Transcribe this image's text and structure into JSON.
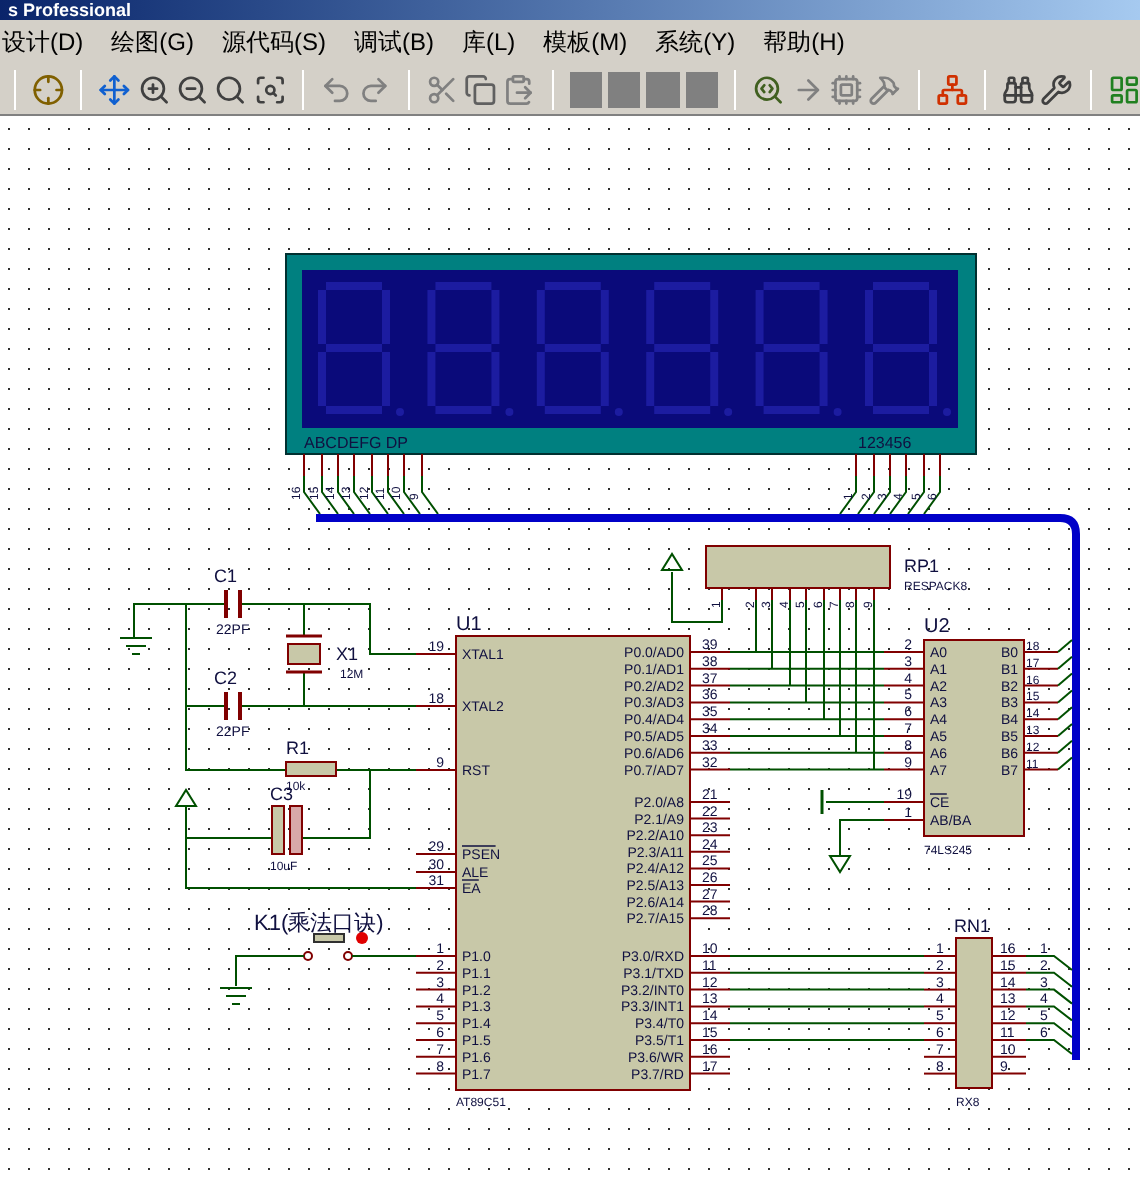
{
  "window": {
    "title": "s Professional"
  },
  "menu": [
    {
      "label": "设计(D)"
    },
    {
      "label": "绘图(G)"
    },
    {
      "label": "源代码(S)"
    },
    {
      "label": "调试(B)"
    },
    {
      "label": "库(L)"
    },
    {
      "label": "模板(M)"
    },
    {
      "label": "系统(Y)"
    },
    {
      "label": "帮助(H)"
    }
  ],
  "schematic": {
    "display": {
      "segment_label": "ABCDEFG DP",
      "digit_label": "123456",
      "segment_pins": [
        "16",
        "15",
        "14",
        "13",
        "12",
        "11",
        "10",
        "9"
      ],
      "digit_pins": [
        "1",
        "2",
        "3",
        "4",
        "5",
        "6"
      ]
    },
    "rp1": {
      "ref": "RP1",
      "value": "RESPACK8",
      "pins": [
        "1",
        "2",
        "3",
        "4",
        "5",
        "6",
        "7",
        "8",
        "9"
      ]
    },
    "u1": {
      "ref": "U1",
      "part": "AT89C51",
      "left_pins": [
        {
          "name": "XTAL1",
          "number": "19",
          "overline": false
        },
        {
          "name": "XTAL2",
          "number": "18",
          "overline": false
        },
        {
          "name": "RST",
          "number": "9",
          "overline": false
        },
        {
          "name": "PSEN",
          "number": "29",
          "overline": true
        },
        {
          "name": "ALE",
          "number": "30",
          "overline": false
        },
        {
          "name": "EA",
          "number": "31",
          "overline": true
        },
        {
          "name": "P1.0",
          "number": "1",
          "overline": false
        },
        {
          "name": "P1.1",
          "number": "2",
          "overline": false
        },
        {
          "name": "P1.2",
          "number": "3",
          "overline": false
        },
        {
          "name": "P1.3",
          "number": "4",
          "overline": false
        },
        {
          "name": "P1.4",
          "number": "5",
          "overline": false
        },
        {
          "name": "P1.5",
          "number": "6",
          "overline": false
        },
        {
          "name": "P1.6",
          "number": "7",
          "overline": false
        },
        {
          "name": "P1.7",
          "number": "8",
          "overline": false
        }
      ],
      "right_pins": [
        {
          "name": "P0.0/AD0",
          "number": "39"
        },
        {
          "name": "P0.1/AD1",
          "number": "38"
        },
        {
          "name": "P0.2/AD2",
          "number": "37"
        },
        {
          "name": "P0.3/AD3",
          "number": "36"
        },
        {
          "name": "P0.4/AD4",
          "number": "35"
        },
        {
          "name": "P0.5/AD5",
          "number": "34"
        },
        {
          "name": "P0.6/AD6",
          "number": "33"
        },
        {
          "name": "P0.7/AD7",
          "number": "32"
        },
        {
          "name": "P2.0/A8",
          "number": "21"
        },
        {
          "name": "P2.1/A9",
          "number": "22"
        },
        {
          "name": "P2.2/A10",
          "number": "23"
        },
        {
          "name": "P2.3/A11",
          "number": "24"
        },
        {
          "name": "P2.4/A12",
          "number": "25"
        },
        {
          "name": "P2.5/A13",
          "number": "26"
        },
        {
          "name": "P2.6/A14",
          "number": "27"
        },
        {
          "name": "P2.7/A15",
          "number": "28"
        },
        {
          "name": "P3.0/RXD",
          "number": "10"
        },
        {
          "name": "P3.1/TXD",
          "number": "11"
        },
        {
          "name": "P3.2/INT0",
          "number": "12"
        },
        {
          "name": "P3.3/INT1",
          "number": "13"
        },
        {
          "name": "P3.4/T0",
          "number": "14"
        },
        {
          "name": "P3.5/T1",
          "number": "15"
        },
        {
          "name": "P3.6/WR",
          "number": "16"
        },
        {
          "name": "P3.7/RD",
          "number": "17"
        }
      ]
    },
    "u2": {
      "ref": "U2",
      "part": "74LS245",
      "left_pins": [
        {
          "name": "A0",
          "number": "2",
          "overline": false
        },
        {
          "name": "A1",
          "number": "3",
          "overline": false
        },
        {
          "name": "A2",
          "number": "4",
          "overline": false
        },
        {
          "name": "A3",
          "number": "5",
          "overline": false
        },
        {
          "name": "A4",
          "number": "6",
          "overline": false
        },
        {
          "name": "A5",
          "number": "7",
          "overline": false
        },
        {
          "name": "A6",
          "number": "8",
          "overline": false
        },
        {
          "name": "A7",
          "number": "9",
          "overline": false
        },
        {
          "name": "CE",
          "number": "19",
          "overline": true
        },
        {
          "name": "AB/BA",
          "number": "1",
          "overline": false
        }
      ],
      "right_pins": [
        {
          "name": "B0",
          "number": "18"
        },
        {
          "name": "B1",
          "number": "17"
        },
        {
          "name": "B2",
          "number": "16"
        },
        {
          "name": "B3",
          "number": "15"
        },
        {
          "name": "B4",
          "number": "14"
        },
        {
          "name": "B5",
          "number": "13"
        },
        {
          "name": "B6",
          "number": "12"
        },
        {
          "name": "B7",
          "number": "11"
        }
      ]
    },
    "rn1": {
      "ref": "RN1",
      "part": "RX8",
      "left_pins": [
        "1",
        "2",
        "3",
        "4",
        "5",
        "6",
        "7",
        "8"
      ],
      "right_pins": [
        "16",
        "15",
        "14",
        "13",
        "12",
        "11",
        "10",
        "9"
      ],
      "bus_labels": [
        "1",
        "2",
        "3",
        "4",
        "5",
        "6"
      ]
    },
    "passives": [
      {
        "kind": "capacitor",
        "ref": "C1",
        "value": "22PF"
      },
      {
        "kind": "capacitor",
        "ref": "C2",
        "value": "22PF"
      },
      {
        "kind": "crystal",
        "ref": "X1",
        "value": "12M"
      },
      {
        "kind": "resistor",
        "ref": "R1",
        "value": "10k"
      },
      {
        "kind": "electrolytic",
        "ref": "C3",
        "value": "10uF"
      }
    ],
    "switch": {
      "label": "K1(乘法口诀)"
    }
  }
}
